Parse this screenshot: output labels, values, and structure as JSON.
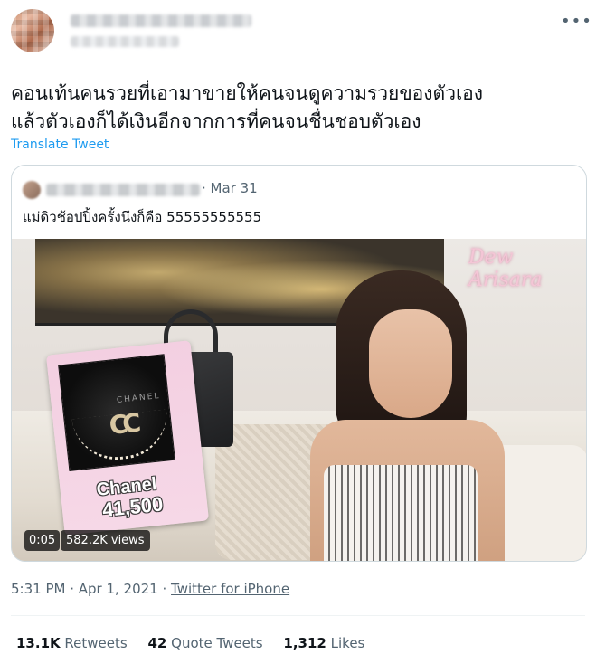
{
  "header": {
    "more_icon": "more-horizontal-icon",
    "more_glyph": "•••"
  },
  "tweet": {
    "text": "คอนเท้นคนรวยที่เอามาขายให้คนจนดูความรวยของตัวเอง\nแล้วตัวเองก็ได้เงินอีกจากการที่คนจนชื่นชอบตัวเอง",
    "translate_label": "Translate Tweet",
    "timestamp": "5:31 PM · Apr 1, 2021 · ",
    "client": "Twitter for iPhone"
  },
  "quote": {
    "date": "· Mar 31",
    "text": "แม่ดิวช้อปปิ้งครั้งนึงก็คือ 55555555555",
    "video": {
      "duration": "0:05",
      "views": "582.2K views",
      "watermark": "Dew Arisara",
      "product_brand": "CHANEL",
      "product_logo": "CC",
      "product_name": "Chanel",
      "product_price": "41,500"
    }
  },
  "stats": {
    "retweets_count": "13.1K",
    "retweets_label": "Retweets",
    "quotes_count": "42",
    "quotes_label": "Quote Tweets",
    "likes_count": "1,312",
    "likes_label": "Likes"
  },
  "colors": {
    "link": "#1d9bf0",
    "secondary_text": "#536471",
    "primary_text": "#0f1419",
    "border": "#cfd9de"
  }
}
